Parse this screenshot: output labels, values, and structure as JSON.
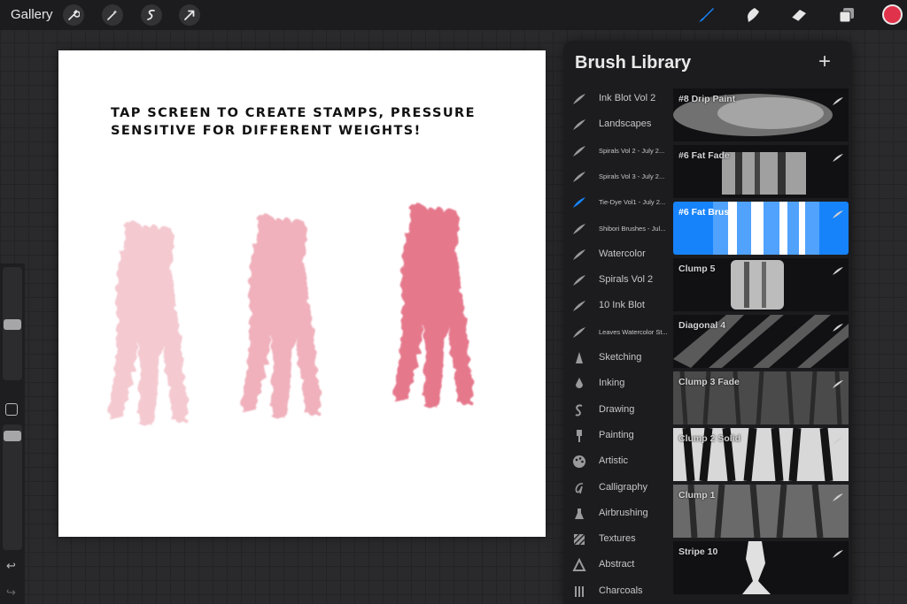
{
  "topbar": {
    "gallery_label": "Gallery",
    "left_tools": [
      "wrench-icon",
      "magic-wand-icon",
      "selection-icon",
      "transform-arrow-icon"
    ],
    "right_tools": [
      "brush-icon",
      "smudge-icon",
      "eraser-icon",
      "layers-icon"
    ],
    "active_tool": "brush-icon",
    "active_color": "#e0324a",
    "accent": "#1683fb"
  },
  "sidebar": {
    "size_slider_level": 0.5,
    "opacity_slider_level": 0.15,
    "undo_icon": "undo-icon",
    "redo_icon": "redo-icon"
  },
  "canvas": {
    "instruction": "TAP SCREEN TO CREATE STAMPS, PRESSURE SENSITIVE FOR DIFFERENT WEIGHTS!",
    "stamp_colors": [
      "#f4c9d0",
      "#f0b1bc",
      "#e6788c"
    ]
  },
  "library": {
    "title": "Brush Library",
    "add_icon": "plus-icon",
    "categories": [
      {
        "label": "Ink Blot Vol 2",
        "icon": "feather-icon",
        "small": false
      },
      {
        "label": "Landscapes",
        "icon": "feather-icon",
        "small": false
      },
      {
        "label": "Spirals Vol 2 - July 2...",
        "icon": "feather-icon",
        "small": true
      },
      {
        "label": "Spirals Vol 3 - July 2...",
        "icon": "feather-icon",
        "small": true
      },
      {
        "label": "Tie-Dye Vol1 - July 2...",
        "icon": "feather-icon",
        "small": true,
        "active": true
      },
      {
        "label": "Shibori Brushes - Jul...",
        "icon": "feather-icon",
        "small": true
      },
      {
        "label": "Watercolor",
        "icon": "feather-icon",
        "small": false
      },
      {
        "label": "Spirals Vol 2",
        "icon": "feather-icon",
        "small": false
      },
      {
        "label": "10 Ink Blot",
        "icon": "feather-icon",
        "small": false
      },
      {
        "label": "Leaves Watercolor St...",
        "icon": "feather-icon",
        "small": true
      },
      {
        "label": "Sketching",
        "icon": "pencil-tip-icon",
        "small": false
      },
      {
        "label": "Inking",
        "icon": "ink-drop-icon",
        "small": false
      },
      {
        "label": "Drawing",
        "icon": "squiggle-icon",
        "small": false
      },
      {
        "label": "Painting",
        "icon": "paint-brush-icon",
        "small": false
      },
      {
        "label": "Artistic",
        "icon": "palette-icon",
        "small": false
      },
      {
        "label": "Calligraphy",
        "icon": "calligraphy-icon",
        "small": false
      },
      {
        "label": "Airbrushing",
        "icon": "airbrush-icon",
        "small": false
      },
      {
        "label": "Textures",
        "icon": "texture-icon",
        "small": false
      },
      {
        "label": "Abstract",
        "icon": "triangle-icon",
        "small": false
      },
      {
        "label": "Charcoals",
        "icon": "charcoal-icon",
        "small": false
      }
    ],
    "brushes": [
      {
        "name": "#8 Drip Paint",
        "selected": false
      },
      {
        "name": "#6 Fat Fade",
        "selected": false
      },
      {
        "name": "#6 Fat Brush",
        "selected": true
      },
      {
        "name": "Clump 5",
        "selected": false
      },
      {
        "name": "Diagonal 4",
        "selected": false
      },
      {
        "name": "Clump 3 Fade",
        "selected": false
      },
      {
        "name": "Clump 2 Solid",
        "selected": false
      },
      {
        "name": "Clump 1",
        "selected": false
      },
      {
        "name": "Stripe 10",
        "selected": false
      }
    ]
  }
}
